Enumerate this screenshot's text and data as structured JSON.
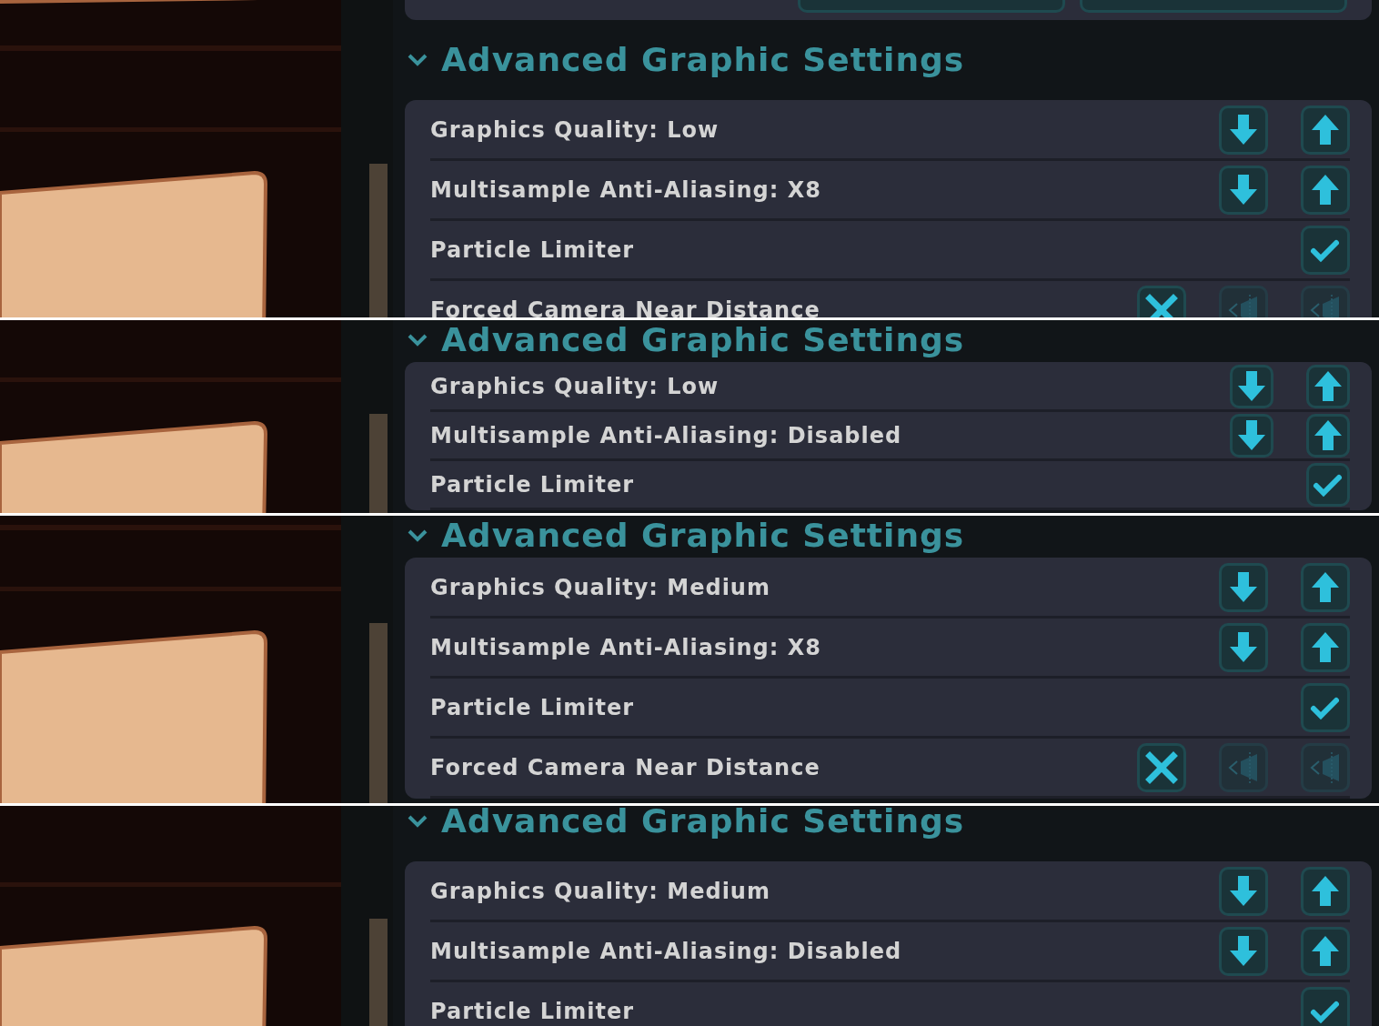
{
  "strips": [
    {
      "blocks": [
        {
          "kind": "card-end"
        },
        {
          "kind": "heading",
          "title": "Advanced Graphic Settings",
          "expanded": true
        },
        {
          "kind": "settings",
          "rows": [
            {
              "kind": "stepper",
              "label": "Graphics Quality: Low"
            },
            {
              "kind": "stepper",
              "label": "Multisample Anti-Aliasing: X8"
            },
            {
              "kind": "toggle",
              "label": "Particle Limiter",
              "checked": true
            },
            {
              "kind": "camera",
              "label": "Forced Camera Near Distance",
              "checked": false,
              "disabled": true
            }
          ]
        }
      ]
    },
    {
      "blocks": [
        {
          "kind": "heading",
          "title": "Advanced Graphic Settings",
          "expanded": true
        },
        {
          "kind": "settings",
          "rows": [
            {
              "kind": "stepper",
              "label": "Graphics Quality: Low"
            },
            {
              "kind": "stepper",
              "label": "Multisample Anti-Aliasing: Disabled"
            },
            {
              "kind": "toggle",
              "label": "Particle Limiter",
              "checked": true
            }
          ]
        }
      ]
    },
    {
      "blocks": [
        {
          "kind": "heading",
          "title": "Advanced Graphic Settings",
          "expanded": true
        },
        {
          "kind": "settings",
          "rows": [
            {
              "kind": "stepper",
              "label": "Graphics Quality: Medium"
            },
            {
              "kind": "stepper",
              "label": "Multisample Anti-Aliasing: X8"
            },
            {
              "kind": "toggle",
              "label": "Particle Limiter",
              "checked": true
            },
            {
              "kind": "camera",
              "label": "Forced Camera Near Distance",
              "checked": false,
              "disabled": true
            }
          ]
        }
      ]
    },
    {
      "blocks": [
        {
          "kind": "heading",
          "title": "Advanced Graphic Settings",
          "expanded": true
        },
        {
          "kind": "settings",
          "rows": [
            {
              "kind": "stepper",
              "label": "Graphics Quality: Medium"
            },
            {
              "kind": "stepper",
              "label": "Multisample Anti-Aliasing: Disabled"
            },
            {
              "kind": "toggle",
              "label": "Particle Limiter",
              "checked": true
            }
          ]
        }
      ]
    }
  ]
}
